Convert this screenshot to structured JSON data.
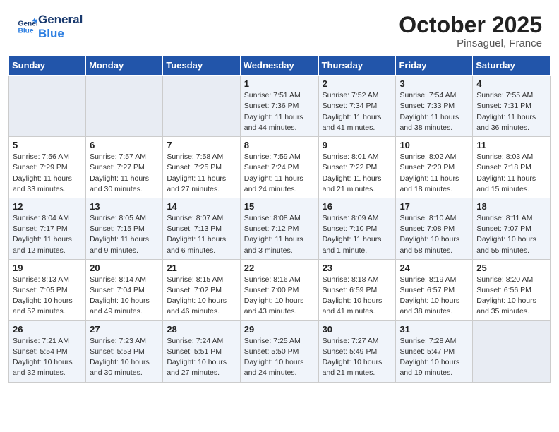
{
  "header": {
    "logo_line1": "General",
    "logo_line2": "Blue",
    "month": "October 2025",
    "location": "Pinsaguel, France"
  },
  "weekdays": [
    "Sunday",
    "Monday",
    "Tuesday",
    "Wednesday",
    "Thursday",
    "Friday",
    "Saturday"
  ],
  "weeks": [
    [
      {
        "day": "",
        "info": ""
      },
      {
        "day": "",
        "info": ""
      },
      {
        "day": "",
        "info": ""
      },
      {
        "day": "1",
        "info": "Sunrise: 7:51 AM\nSunset: 7:36 PM\nDaylight: 11 hours\nand 44 minutes."
      },
      {
        "day": "2",
        "info": "Sunrise: 7:52 AM\nSunset: 7:34 PM\nDaylight: 11 hours\nand 41 minutes."
      },
      {
        "day": "3",
        "info": "Sunrise: 7:54 AM\nSunset: 7:33 PM\nDaylight: 11 hours\nand 38 minutes."
      },
      {
        "day": "4",
        "info": "Sunrise: 7:55 AM\nSunset: 7:31 PM\nDaylight: 11 hours\nand 36 minutes."
      }
    ],
    [
      {
        "day": "5",
        "info": "Sunrise: 7:56 AM\nSunset: 7:29 PM\nDaylight: 11 hours\nand 33 minutes."
      },
      {
        "day": "6",
        "info": "Sunrise: 7:57 AM\nSunset: 7:27 PM\nDaylight: 11 hours\nand 30 minutes."
      },
      {
        "day": "7",
        "info": "Sunrise: 7:58 AM\nSunset: 7:25 PM\nDaylight: 11 hours\nand 27 minutes."
      },
      {
        "day": "8",
        "info": "Sunrise: 7:59 AM\nSunset: 7:24 PM\nDaylight: 11 hours\nand 24 minutes."
      },
      {
        "day": "9",
        "info": "Sunrise: 8:01 AM\nSunset: 7:22 PM\nDaylight: 11 hours\nand 21 minutes."
      },
      {
        "day": "10",
        "info": "Sunrise: 8:02 AM\nSunset: 7:20 PM\nDaylight: 11 hours\nand 18 minutes."
      },
      {
        "day": "11",
        "info": "Sunrise: 8:03 AM\nSunset: 7:18 PM\nDaylight: 11 hours\nand 15 minutes."
      }
    ],
    [
      {
        "day": "12",
        "info": "Sunrise: 8:04 AM\nSunset: 7:17 PM\nDaylight: 11 hours\nand 12 minutes."
      },
      {
        "day": "13",
        "info": "Sunrise: 8:05 AM\nSunset: 7:15 PM\nDaylight: 11 hours\nand 9 minutes."
      },
      {
        "day": "14",
        "info": "Sunrise: 8:07 AM\nSunset: 7:13 PM\nDaylight: 11 hours\nand 6 minutes."
      },
      {
        "day": "15",
        "info": "Sunrise: 8:08 AM\nSunset: 7:12 PM\nDaylight: 11 hours\nand 3 minutes."
      },
      {
        "day": "16",
        "info": "Sunrise: 8:09 AM\nSunset: 7:10 PM\nDaylight: 11 hours\nand 1 minute."
      },
      {
        "day": "17",
        "info": "Sunrise: 8:10 AM\nSunset: 7:08 PM\nDaylight: 10 hours\nand 58 minutes."
      },
      {
        "day": "18",
        "info": "Sunrise: 8:11 AM\nSunset: 7:07 PM\nDaylight: 10 hours\nand 55 minutes."
      }
    ],
    [
      {
        "day": "19",
        "info": "Sunrise: 8:13 AM\nSunset: 7:05 PM\nDaylight: 10 hours\nand 52 minutes."
      },
      {
        "day": "20",
        "info": "Sunrise: 8:14 AM\nSunset: 7:04 PM\nDaylight: 10 hours\nand 49 minutes."
      },
      {
        "day": "21",
        "info": "Sunrise: 8:15 AM\nSunset: 7:02 PM\nDaylight: 10 hours\nand 46 minutes."
      },
      {
        "day": "22",
        "info": "Sunrise: 8:16 AM\nSunset: 7:00 PM\nDaylight: 10 hours\nand 43 minutes."
      },
      {
        "day": "23",
        "info": "Sunrise: 8:18 AM\nSunset: 6:59 PM\nDaylight: 10 hours\nand 41 minutes."
      },
      {
        "day": "24",
        "info": "Sunrise: 8:19 AM\nSunset: 6:57 PM\nDaylight: 10 hours\nand 38 minutes."
      },
      {
        "day": "25",
        "info": "Sunrise: 8:20 AM\nSunset: 6:56 PM\nDaylight: 10 hours\nand 35 minutes."
      }
    ],
    [
      {
        "day": "26",
        "info": "Sunrise: 7:21 AM\nSunset: 5:54 PM\nDaylight: 10 hours\nand 32 minutes."
      },
      {
        "day": "27",
        "info": "Sunrise: 7:23 AM\nSunset: 5:53 PM\nDaylight: 10 hours\nand 30 minutes."
      },
      {
        "day": "28",
        "info": "Sunrise: 7:24 AM\nSunset: 5:51 PM\nDaylight: 10 hours\nand 27 minutes."
      },
      {
        "day": "29",
        "info": "Sunrise: 7:25 AM\nSunset: 5:50 PM\nDaylight: 10 hours\nand 24 minutes."
      },
      {
        "day": "30",
        "info": "Sunrise: 7:27 AM\nSunset: 5:49 PM\nDaylight: 10 hours\nand 21 minutes."
      },
      {
        "day": "31",
        "info": "Sunrise: 7:28 AM\nSunset: 5:47 PM\nDaylight: 10 hours\nand 19 minutes."
      },
      {
        "day": "",
        "info": ""
      }
    ]
  ]
}
